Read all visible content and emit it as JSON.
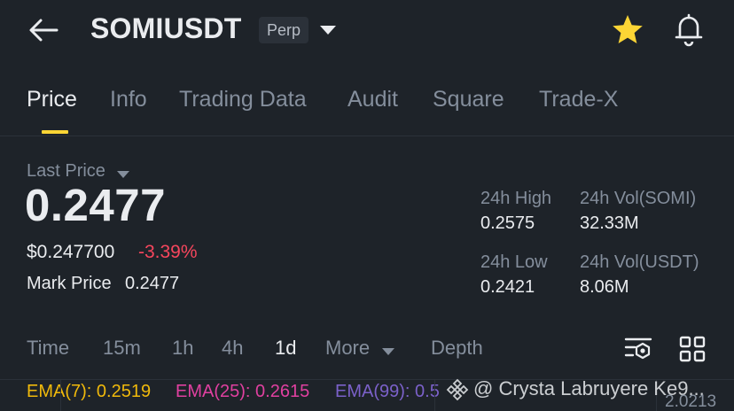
{
  "header": {
    "symbol": "SOMIUSDT",
    "badge": "Perp",
    "icons": [
      "back-arrow-icon",
      "chevron-down-icon",
      "star-icon",
      "bell-icon"
    ],
    "star_color": "#fcd535"
  },
  "tabs": [
    {
      "label": "Price",
      "active": true
    },
    {
      "label": "Info"
    },
    {
      "label": "Trading Data"
    },
    {
      "label": "Audit"
    },
    {
      "label": "Square"
    },
    {
      "label": "Trade-X"
    }
  ],
  "price": {
    "last_price_label": "Last Price",
    "last_price": "0.2477",
    "usd_price": "$0.247700",
    "change_pct": "-3.39%",
    "mark_price_label": "Mark Price",
    "mark_price": "0.2477"
  },
  "stats": {
    "high_label": "24h High",
    "high": "0.2575",
    "vol_base_label": "24h Vol(SOMI)",
    "vol_base": "32.33M",
    "low_label": "24h Low",
    "low": "0.2421",
    "vol_quote_label": "24h Vol(USDT)",
    "vol_quote": "8.06M"
  },
  "intervals": {
    "time": "Time",
    "m15": "15m",
    "h1": "1h",
    "h4": "4h",
    "d1": "1d",
    "more": "More",
    "depth": "Depth",
    "active": "1d"
  },
  "ema": {
    "ema7": "EMA(7): 0.2519",
    "ema25": "EMA(25): 0.2615",
    "ema99": "EMA(99): 0.5",
    "colors": {
      "ema7": "#f0b90b",
      "ema25": "#e040a0",
      "ema99": "#7b61c9"
    }
  },
  "watermark": "@ Crysta Labruyere Ke9...",
  "axis_value": "2.0213",
  "colors": {
    "background": "#1e2329",
    "accent": "#fcd535",
    "negative": "#f6465d",
    "muted": "#848e9c"
  }
}
